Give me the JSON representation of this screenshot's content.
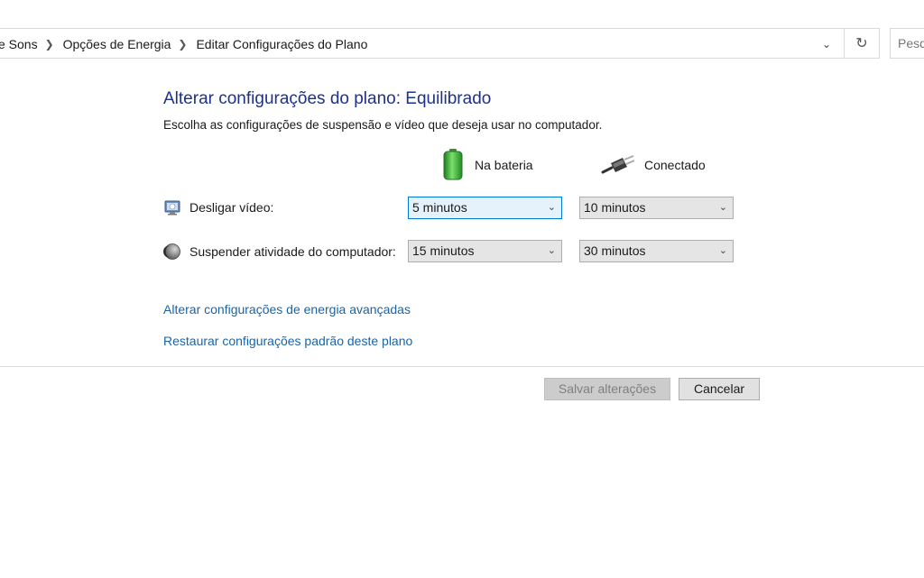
{
  "address": {
    "breadcrumbs": [
      "e Sons",
      "Opções de Energia",
      "Editar Configurações do Plano"
    ],
    "search_placeholder": "Pesq"
  },
  "page": {
    "title": "Alterar configurações do plano: Equilibrado",
    "subtitle": "Escolha as configurações de suspensão e vídeo que deseja usar no computador."
  },
  "columns": {
    "battery": "Na bateria",
    "plugged": "Conectado"
  },
  "settings": [
    {
      "label": "Desligar vídeo:",
      "battery": "5 minutos",
      "plugged": "10 minutos"
    },
    {
      "label": "Suspender atividade do computador:",
      "battery": "15 minutos",
      "plugged": "30 minutos"
    }
  ],
  "links": {
    "advanced": "Alterar configurações de energia avançadas",
    "restore": "Restaurar configurações padrão deste plano"
  },
  "buttons": {
    "save": "Salvar alterações",
    "cancel": "Cancelar"
  },
  "colors": {
    "title": "#1e3287",
    "link": "#1a64a8",
    "focus_border": "#0078d7"
  }
}
